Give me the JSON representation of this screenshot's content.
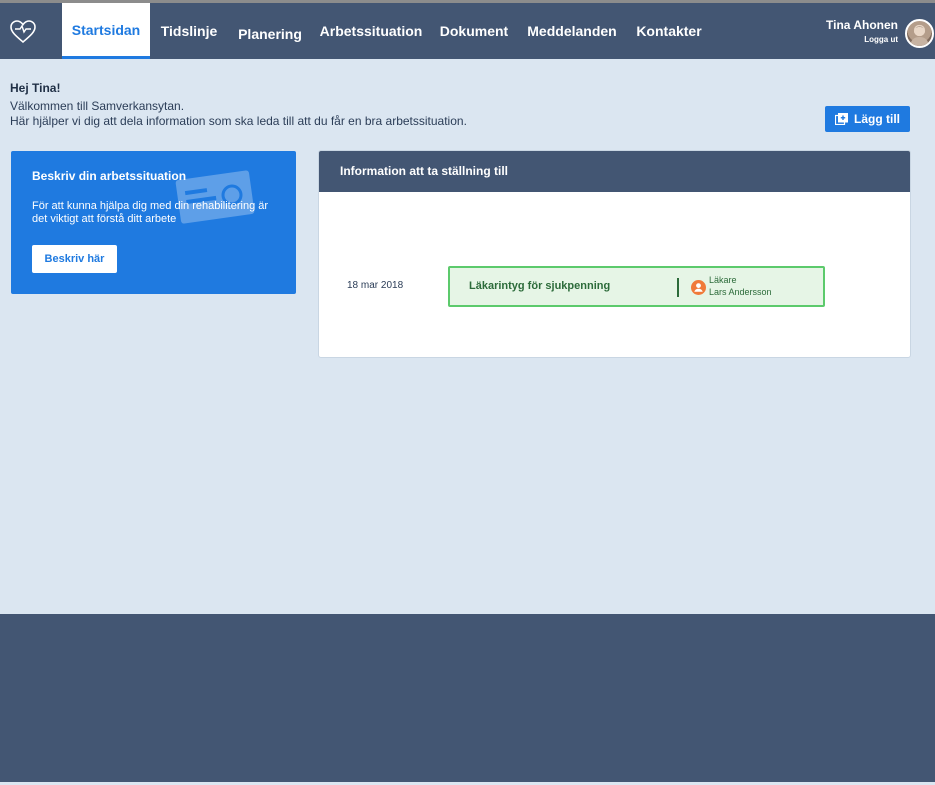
{
  "nav": {
    "logo_icon": "heart-outline-icon",
    "tabs": [
      {
        "label": "Startsidan",
        "active": true
      },
      {
        "label": "Tidslinje",
        "active": false
      },
      {
        "label": "Planering",
        "active": false
      },
      {
        "label": "Arbetssituation",
        "active": false
      },
      {
        "label": "Dokument",
        "active": false
      },
      {
        "label": "Meddelanden",
        "active": false
      },
      {
        "label": "Kontakter",
        "active": false
      }
    ],
    "user": {
      "name": "Tina Ahonen",
      "logout": "Logga ut"
    }
  },
  "welcome": {
    "title": "Hej Tina!",
    "line1": "Välkommen till Samverkansytan.",
    "line2": "Här hjälper vi dig att dela information som ska leda till att du får en bra arbetssituation."
  },
  "add_button": {
    "label": "Lägg till",
    "icon": "add-document-icon"
  },
  "describe_card": {
    "title": "Beskriv din arbetssituation",
    "text": "För att kunna hjälpa dig med din rehabilitering är det viktigt att förstå ditt arbete",
    "button": "Beskriv här"
  },
  "info_panel": {
    "title": "Information att ta ställning till",
    "items": [
      {
        "date": "18 mar 2018",
        "title": "Läkarintyg för sjukpenning",
        "role": "Läkare",
        "name": "Lars Andersson"
      }
    ]
  },
  "colors": {
    "nav_bg": "#435673",
    "page_bg": "#dbe6f1",
    "accent": "#1f7ae0",
    "success_border": "#5cca6c",
    "success_text": "#2c6b3a",
    "user_icon": "#f07a3a"
  }
}
